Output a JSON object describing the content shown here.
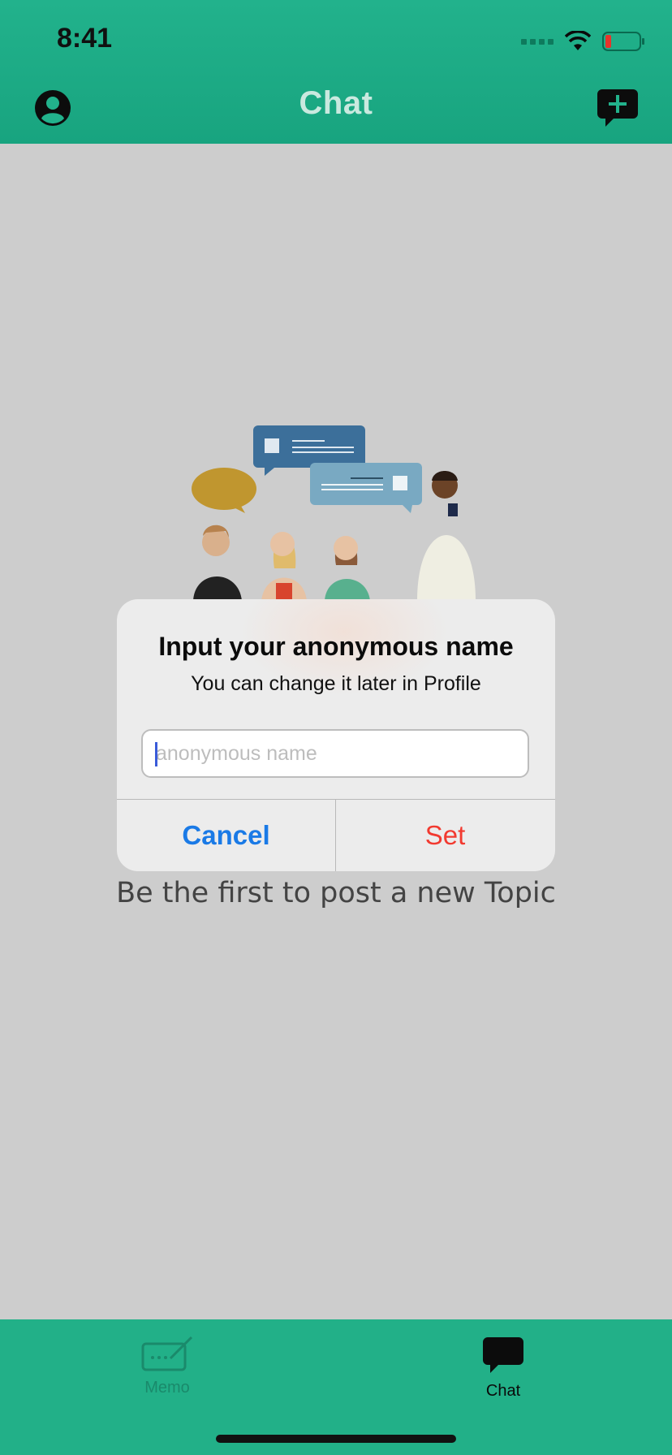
{
  "status_bar": {
    "time": "8:41"
  },
  "nav": {
    "title": "Chat"
  },
  "empty_state": {
    "text": "Be the first to post a new Topic"
  },
  "dialog": {
    "title": "Input your anonymous name",
    "message": "You can change it later in Profile",
    "input_placeholder": "anonymous name",
    "input_value": "",
    "cancel_label": "Cancel",
    "set_label": "Set"
  },
  "tabbar": {
    "tabs": [
      {
        "label": "Memo",
        "selected": false
      },
      {
        "label": "Chat",
        "selected": true
      }
    ]
  },
  "colors": {
    "brand_green": "#22b28c",
    "cancel_blue": "#1a7ae6",
    "set_red": "#f23a30"
  }
}
